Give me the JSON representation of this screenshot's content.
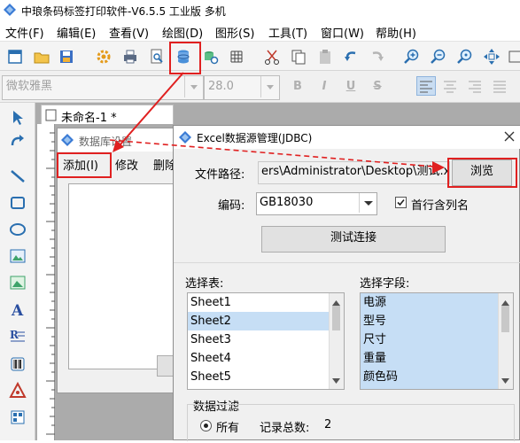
{
  "window": {
    "title": "中琅条码标签打印软件-V6.5.5 工业版 多机"
  },
  "menu": [
    {
      "label": "文件(F)"
    },
    {
      "label": "编辑(E)"
    },
    {
      "label": "查看(V)"
    },
    {
      "label": "绘图(D)"
    },
    {
      "label": "图形(S)"
    },
    {
      "label": "工具(T)"
    },
    {
      "label": "窗口(W)"
    },
    {
      "label": "帮助(H)"
    }
  ],
  "format": {
    "font": "微软雅黑",
    "size": "28.0",
    "bold": "B",
    "italic": "I",
    "underline": "U",
    "strike": "S"
  },
  "document_tab": {
    "label": "未命名-1 *"
  },
  "db_dialog": {
    "title": "数据库设置",
    "menu": {
      "add": "添加(I)",
      "modify": "修改",
      "delete": "删除"
    }
  },
  "excel_dialog": {
    "title": "Excel数据源管理(JDBC)",
    "file_path_label": "文件路径:",
    "file_path_value": "ers\\Administrator\\Desktop\\测试.xls",
    "browse": "浏览",
    "encoding_label": "编码:",
    "encoding_value": "GB18030",
    "first_row_label": "首行含列名",
    "first_row_checked": true,
    "test_button": "测试连接",
    "table_label": "选择表:",
    "tables": [
      "Sheet1",
      "Sheet2",
      "Sheet3",
      "Sheet4",
      "Sheet5"
    ],
    "selected_table": "Sheet2",
    "field_label": "选择字段:",
    "fields": [
      "电源",
      "型号",
      "尺寸",
      "重量",
      "颜色码"
    ],
    "filter_label": "数据过滤",
    "all_label": "所有",
    "record_count_label": "记录总数:",
    "record_count": "2"
  },
  "colors": {
    "highlight": "#cce8ff",
    "annotation": "#e02020",
    "selection": "#c6def5"
  }
}
